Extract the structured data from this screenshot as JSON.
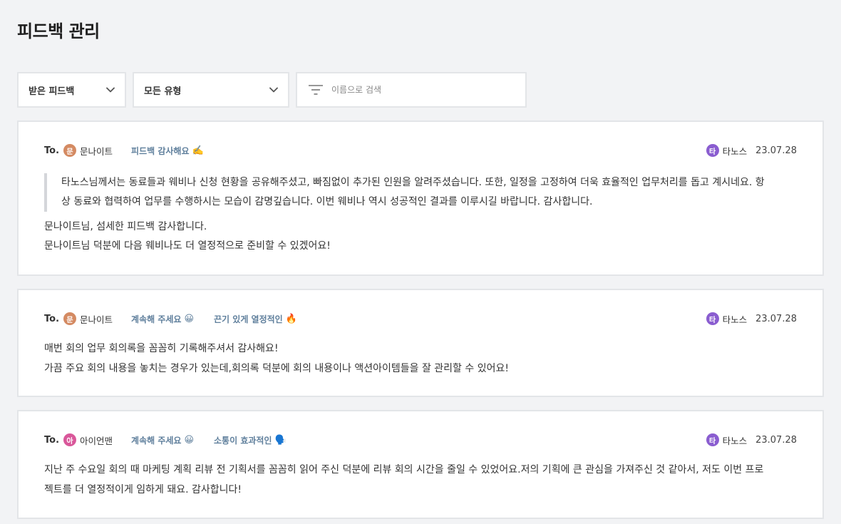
{
  "page": {
    "title": "피드백 관리"
  },
  "filters": {
    "received": {
      "label": "받은 피드백"
    },
    "type": {
      "label": "모든 유형"
    },
    "search": {
      "placeholder": "이름으로 검색",
      "value": ""
    }
  },
  "colors": {
    "background": "#f2f3f5",
    "tag_text": "#5f7f9c",
    "avatar_moon": "#d48a62",
    "avatar_iron": "#d9579a",
    "avatar_thanos": "#8a5dd0",
    "card_border": "#e3e5e8"
  },
  "feedbacks": [
    {
      "to_label": "To.",
      "recipient": {
        "initial": "문",
        "name": "문나이트"
      },
      "tags": [
        {
          "label": "피드백 감사해요",
          "emoji": "✍️"
        }
      ],
      "sender": {
        "initial": "타",
        "name": "타노스"
      },
      "date": "23.07.28",
      "quote_lines": [
        "타노스님께서는 동료들과 웨비나 신청 현황을 공유해주셨고, 빠짐없이 추가된 인원을 알려주셨습니다. 또한, 일정을 고정하여 더욱 효율적인 업무처리를 돕고 계시네요. 항",
        "상 동료와 협력하여 업무를 수행하시는 모습이 감명깊습니다. 이번 웨비나 역시 성공적인 결과를 이루시길 바랍니다. 감사합니다."
      ],
      "reply_lines": [
        "문나이트님, 섬세한 피드백 감사합니다.",
        "문나이트님 덕분에 다음 웨비나도 더 열정적으로 준비할 수 있겠어요!"
      ]
    },
    {
      "to_label": "To.",
      "recipient": {
        "initial": "문",
        "name": "문나이트"
      },
      "tags": [
        {
          "label": "계속해 주세요",
          "emoji": "😀"
        },
        {
          "label": "끈기 있게 열정적인",
          "emoji": "🔥"
        }
      ],
      "sender": {
        "initial": "타",
        "name": "타노스"
      },
      "date": "23.07.28",
      "body_lines": [
        "매번 회의 업무 회의록을 꼼꼼히 기록해주셔서 감사해요!",
        "가끔 주요 회의 내용을 놓치는 경우가 있는데,회의록 덕분에 회의 내용이나 액션아이템들을 잘 관리할 수 있어요!"
      ]
    },
    {
      "to_label": "To.",
      "recipient": {
        "initial": "아",
        "name": "아이언맨"
      },
      "tags": [
        {
          "label": "계속해 주세요",
          "emoji": "😀"
        },
        {
          "label": "소통이 효과적인",
          "emoji": "🗣️"
        }
      ],
      "sender": {
        "initial": "타",
        "name": "타노스"
      },
      "date": "23.07.28",
      "body_lines": [
        "지난 주 수요일 회의 때 마케팅 계획 리뷰 전 기획서를 꼼꼼히 읽어 주신 덕분에 리뷰 회의 시간을 줄일 수 있었어요.저의 기획에 큰 관심을 가져주신 것 같아서, 저도 이번 프로",
        "젝트를 더 열정적이게 임하게 돼요. 감사합니다!"
      ]
    }
  ]
}
